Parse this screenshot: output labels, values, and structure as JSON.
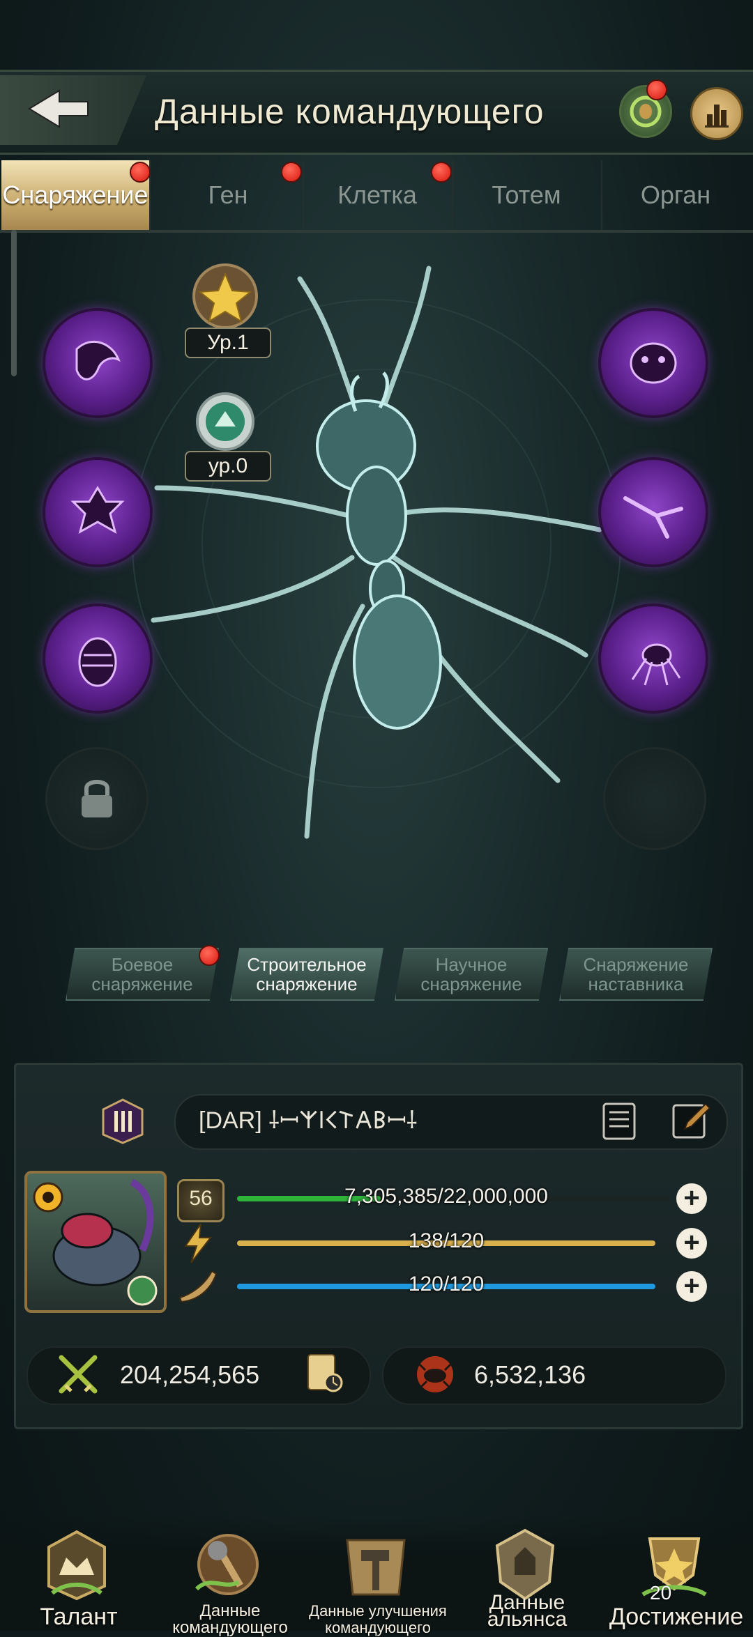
{
  "header": {
    "title": "Данные командующего"
  },
  "tabs": [
    {
      "label": "Снаряжение",
      "active": true,
      "alert": true
    },
    {
      "label": "Ген",
      "active": false,
      "alert": true
    },
    {
      "label": "Клетка",
      "active": false,
      "alert": true
    },
    {
      "label": "Тотем",
      "active": false,
      "alert": false
    },
    {
      "label": "Орган",
      "active": false,
      "alert": false
    }
  ],
  "badges": [
    {
      "label": "Ур.1"
    },
    {
      "label": "ур.0"
    }
  ],
  "subtabs": [
    {
      "label": "Боевое снаряжение",
      "active": false,
      "alert": true
    },
    {
      "label": "Строительное снаряжение",
      "active": true,
      "alert": false
    },
    {
      "label": "Научное снаряжение",
      "active": false,
      "alert": false
    },
    {
      "label": "Снаряжение наставника",
      "active": false,
      "alert": false
    }
  ],
  "commander": {
    "name": "[DAR] ⸸ꟷ𐌙𐌉𐌂𐌕𐌀𐌁ꟷ⸸",
    "level": "56",
    "xp": {
      "label": "7,305,385/22,000,000",
      "fraction": 0.332
    },
    "energy": {
      "label": "138/120",
      "fraction": 1.0
    },
    "stamina": {
      "label": "120/120",
      "fraction": 1.0
    },
    "power": "204,254,565",
    "kills": "6,532,136"
  },
  "nav": [
    {
      "label": "Талант"
    },
    {
      "label": "Данные командующего"
    },
    {
      "label": "Данные улучшения командующего"
    },
    {
      "label": "Данные альянса"
    },
    {
      "label": "Достижение",
      "count": "20"
    }
  ],
  "colors": {
    "accent_gold": "#c8aa6c",
    "slot_purple": "#8e45c8",
    "xp_green": "#2fb33a",
    "energy_gold": "#d8b04c",
    "stamina_blue": "#1f9ae0",
    "alert_red": "#d8180e"
  },
  "icons": {
    "back": "back-arrow-icon",
    "stats": "bar-chart-icon",
    "lock": "lock-icon",
    "edit": "edit-icon",
    "notes": "notes-icon"
  }
}
